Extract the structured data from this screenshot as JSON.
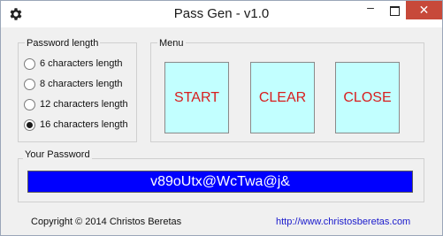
{
  "window": {
    "title": "Pass Gen - v1.0",
    "app_icon": "gear-icon",
    "controls": {
      "minimize": "–",
      "close": "✕"
    }
  },
  "password_length": {
    "label": "Password length",
    "options": [
      {
        "label": "6 characters length",
        "checked": false
      },
      {
        "label": "8 characters length",
        "checked": false
      },
      {
        "label": "12 characters length",
        "checked": false
      },
      {
        "label": "16 characters length",
        "checked": true
      }
    ]
  },
  "menu": {
    "label": "Menu",
    "buttons": {
      "start": "START",
      "clear": "CLEAR",
      "close": "CLOSE"
    }
  },
  "your_password": {
    "label": "Your Password",
    "value": "v89oUtx@WcTwa@j&"
  },
  "footer": {
    "copyright": "Copyright © 2014 Christos Beretas",
    "website": "http://www.christosberetas.com"
  },
  "colors": {
    "button_bg": "#c2ffff",
    "button_text": "#d81e1e",
    "password_bg": "#0000ff",
    "close_button": "#c7493a",
    "link": "#1a1acc"
  }
}
